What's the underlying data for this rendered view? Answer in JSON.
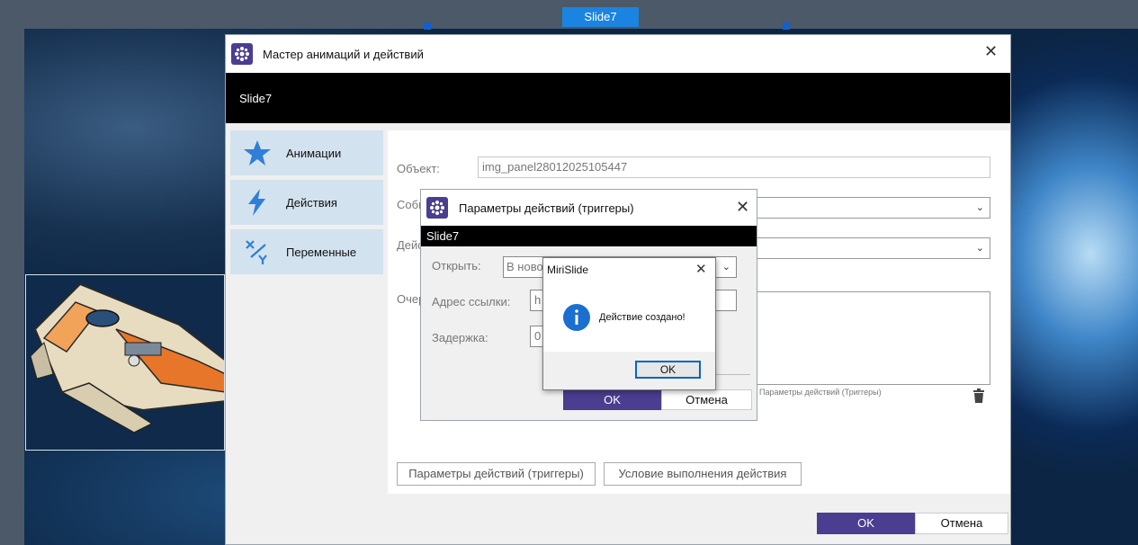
{
  "canvas": {
    "slide_tab": "Slide7"
  },
  "main_dialog": {
    "title": "Мастер анимаций и действий",
    "banner": "Slide7",
    "sidebar": [
      {
        "label": "Анимации",
        "icon": "star-icon"
      },
      {
        "label": "Действия",
        "icon": "lightning-icon"
      },
      {
        "label": "Переменные",
        "icon": "variables-icon"
      }
    ],
    "fields": {
      "object_label": "Объект:",
      "object_value": "img_panel28012025105447",
      "event_label": "Собы",
      "action_label": "Дейс",
      "queue_label": "Очер"
    },
    "caption": "Параметры действий (Триггеры)",
    "triggers_button": "Параметры действий (триггеры)",
    "condition_button": "Условие выполнения действия",
    "ok": "OK",
    "cancel": "Отмена"
  },
  "triggers_dialog": {
    "title": "Параметры действий (триггеры)",
    "banner": "Slide7",
    "open_label": "Открыть:",
    "open_value": "В ново",
    "url_label": "Адрес ссылки:",
    "url_value": "h",
    "delay_label": "Задержка:",
    "delay_value": "0",
    "ok": "OK",
    "cancel": "Отмена"
  },
  "message_box": {
    "title": "MiriSlide",
    "text": "Действие создано!",
    "ok": "OK",
    "icon": "info-icon"
  },
  "colors": {
    "accent": "#4b3d8f",
    "selection_blue": "#1a84e0",
    "sidebar_bg": "#d3e2ef",
    "icon_blue": "#2f7fd8"
  }
}
